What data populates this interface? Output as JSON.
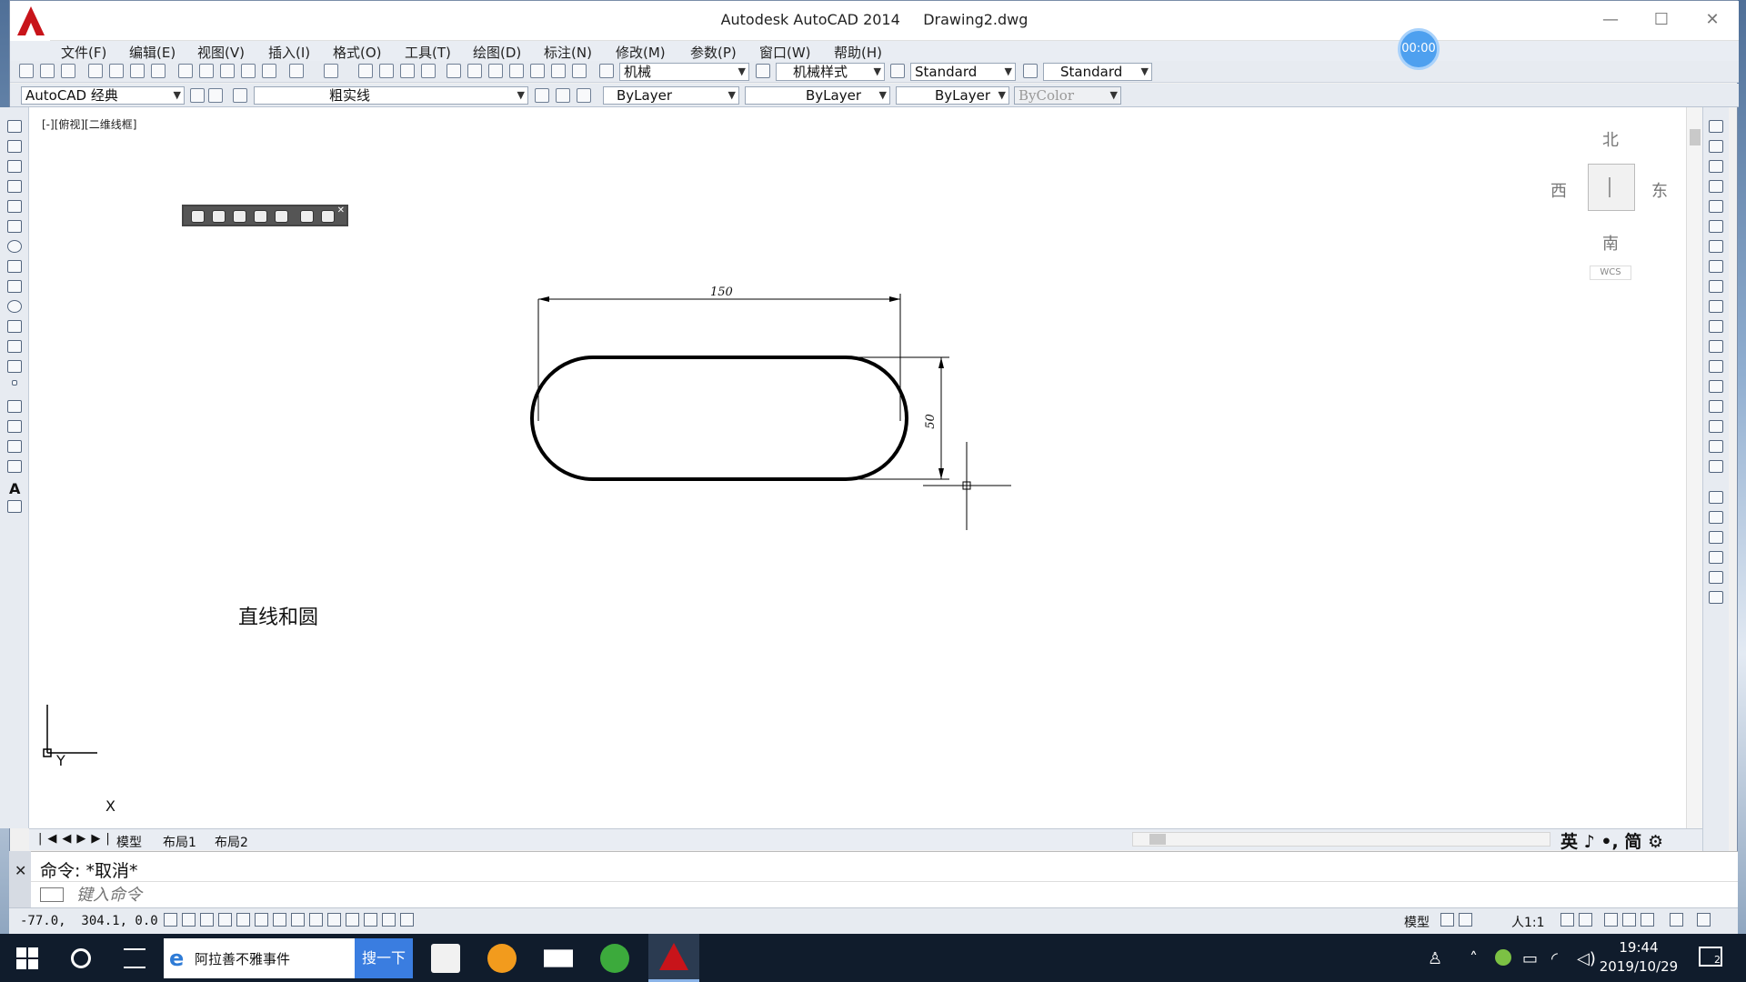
{
  "window": {
    "title": "Autodesk AutoCAD 2014     Drawing2.dwg",
    "minimize": "—",
    "maximize": "☐",
    "close": "✕"
  },
  "menu": {
    "items": [
      "文件(F)",
      "编辑(E)",
      "视图(V)",
      "插入(I)",
      "格式(O)",
      "工具(T)",
      "绘图(D)",
      "标注(N)",
      "修改(M)",
      "参数(P)",
      "窗口(W)",
      "帮助(H)"
    ]
  },
  "timer": "00:00",
  "toolbar1": {
    "text_style": "机械",
    "dim_style": "机械样式",
    "table_style": "Standard",
    "multileader_style": "Standard"
  },
  "toolbar2": {
    "workspace": "AutoCAD 经典",
    "layer": "粗实线",
    "color": "ByLayer",
    "linetype": "ByLayer",
    "lineweight": "ByLayer",
    "plot_style": "ByColor"
  },
  "viewport": {
    "label": "[-][俯视][二维线框]",
    "drawing_label": "直线和圆",
    "dim_horizontal": "150",
    "dim_vertical": "50",
    "ucs_y": "Y",
    "ucs_x": "X"
  },
  "viewcube": {
    "north": "北",
    "south": "南",
    "east": "东",
    "west": "西",
    "wcs": "WCS"
  },
  "tabs": [
    "模型",
    "布局1",
    "布局2"
  ],
  "ime": "英 ♪ •, 简 ⚙",
  "command": {
    "history": "命令: *取消*",
    "placeholder": "键入命令"
  },
  "status": {
    "coords": "-77.0,  304.1, 0.0",
    "model": "模型",
    "scale": "人1:1"
  },
  "taskbar": {
    "browser_text": "阿拉善不雅事件",
    "search_button": "搜一下",
    "time": "19:44",
    "date": "2019/10/29",
    "notif_count": "2"
  }
}
